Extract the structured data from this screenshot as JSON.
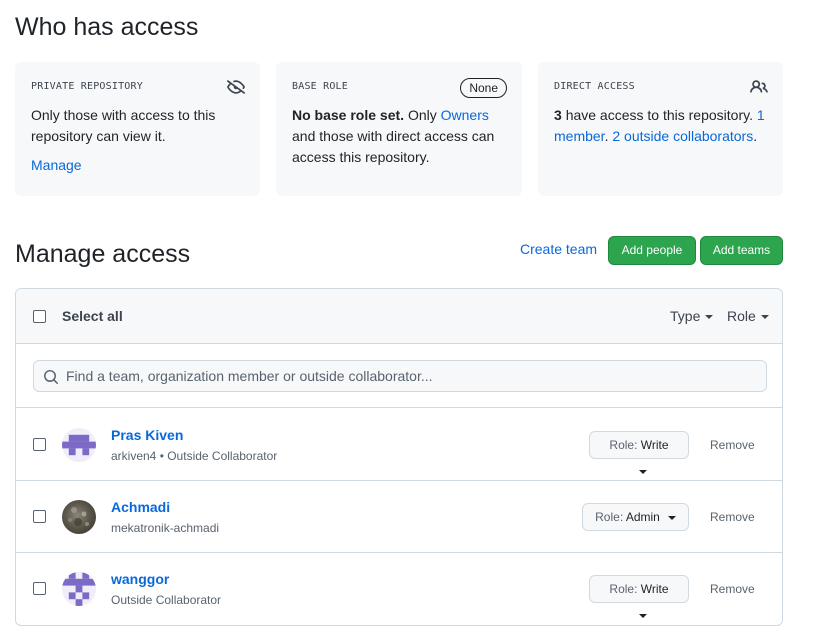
{
  "page": {
    "title": "Who has access",
    "manage_title": "Manage access"
  },
  "cards": {
    "private": {
      "label": "PRIVATE REPOSITORY",
      "text": "Only those with access to this repository can view it.",
      "manage": "Manage",
      "icon": "eye-closed-icon"
    },
    "base_role": {
      "label": "BASE ROLE",
      "badge": "None",
      "bold": "No base role set.",
      "text_1": "Only",
      "link": "Owners",
      "text_2": "and those with direct access can access this repository."
    },
    "direct": {
      "label": "DIRECT ACCESS",
      "count": "3",
      "text": "have access to this repository.",
      "link_member": "1 member",
      "link_outside": "2 outside collaborators",
      "icon": "people-icon"
    }
  },
  "actions": {
    "create_team": "Create team",
    "add_people": "Add people",
    "add_teams": "Add teams"
  },
  "table": {
    "select_all": "Select all",
    "filter_type": "Type",
    "filter_role": "Role",
    "search_placeholder": "Find a team, organization member or outside collaborator...",
    "role_prefix": "Role:",
    "remove_label": "Remove",
    "rows": [
      {
        "name": "Pras Kiven",
        "subtitle": "arkiven4 • Outside Collaborator",
        "role": "Write"
      },
      {
        "name": "Achmadi",
        "subtitle": "mekatronik-achmadi",
        "role": "Admin"
      },
      {
        "name": "wanggor",
        "subtitle": "Outside Collaborator",
        "role": "Write"
      }
    ]
  },
  "colors": {
    "link": "#0969da",
    "primary_button": "#2da44e",
    "avatar_purple": "#7d6ac6"
  }
}
